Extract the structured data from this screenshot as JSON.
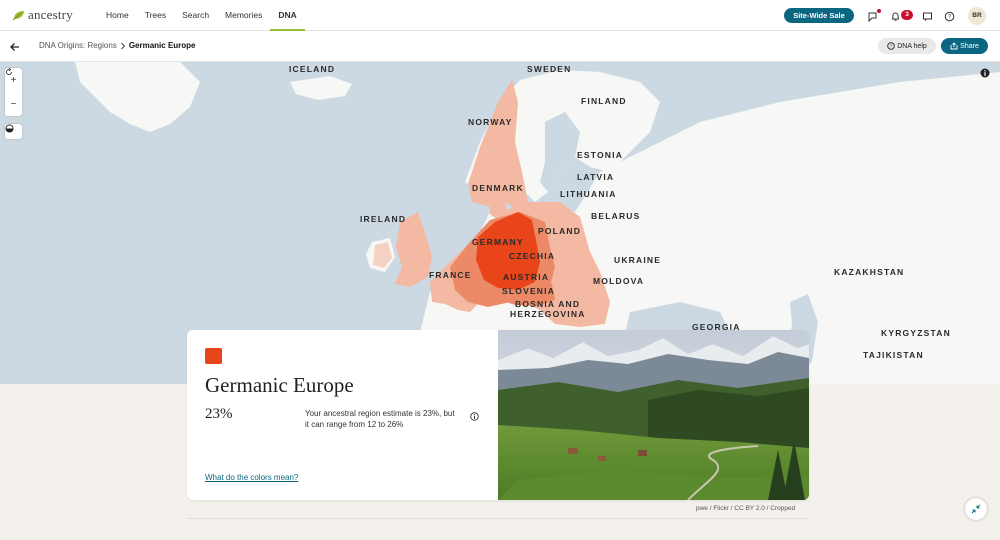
{
  "nav": {
    "logo": "ancestry",
    "links": [
      "Home",
      "Trees",
      "Search",
      "Memories",
      "DNA"
    ],
    "sale_button": "Site-Wide Sale",
    "notification_count": "3",
    "avatar_initials": "BR"
  },
  "subheader": {
    "breadcrumb_parent": "DNA Origins: Regions",
    "breadcrumb_current": "Germanic Europe",
    "help_button": "DNA help",
    "share_button": "Share"
  },
  "map": {
    "labels": {
      "iceland": "ICELAND",
      "sweden": "SWEDEN",
      "finland": "FINLAND",
      "norway": "NORWAY",
      "estonia": "ESTONIA",
      "latvia": "LATVIA",
      "denmark": "DENMARK",
      "lithuania": "LITHUANIA",
      "belarus": "BELARUS",
      "ireland": "IRELAND",
      "poland": "POLAND",
      "germany": "GERMANY",
      "czechia": "CZECHIA",
      "ukraine": "UKRAINE",
      "kazakhstan": "KAZAKHSTAN",
      "france": "FRANCE",
      "austria": "AUSTRIA",
      "moldova": "MOLDOVA",
      "slovenia": "SLOVENIA",
      "bosnia": "BOSNIA AND",
      "herzegovina": "HERZEGOVINA",
      "georgia": "GEORGIA",
      "kyrgyzstan": "KYRGYZSTAN",
      "tajikistan": "TAJIKISTAN"
    },
    "colors": {
      "sea": "#cdd9e2",
      "land": "#f7f7f5",
      "region_core": "#e8461a",
      "region_mid": "#ec8a68",
      "region_light": "#f3b9a2"
    }
  },
  "region": {
    "name": "Germanic Europe",
    "percentage": "23%",
    "estimate_text": "Your ancestral region estimate is 23%, but it can range from 12 to 26%",
    "colors_link": "What do the colors mean?",
    "swatch_color": "#e8461a"
  },
  "photo_credit": "pwe / Flickr / CC BY 2.0 / Cropped"
}
